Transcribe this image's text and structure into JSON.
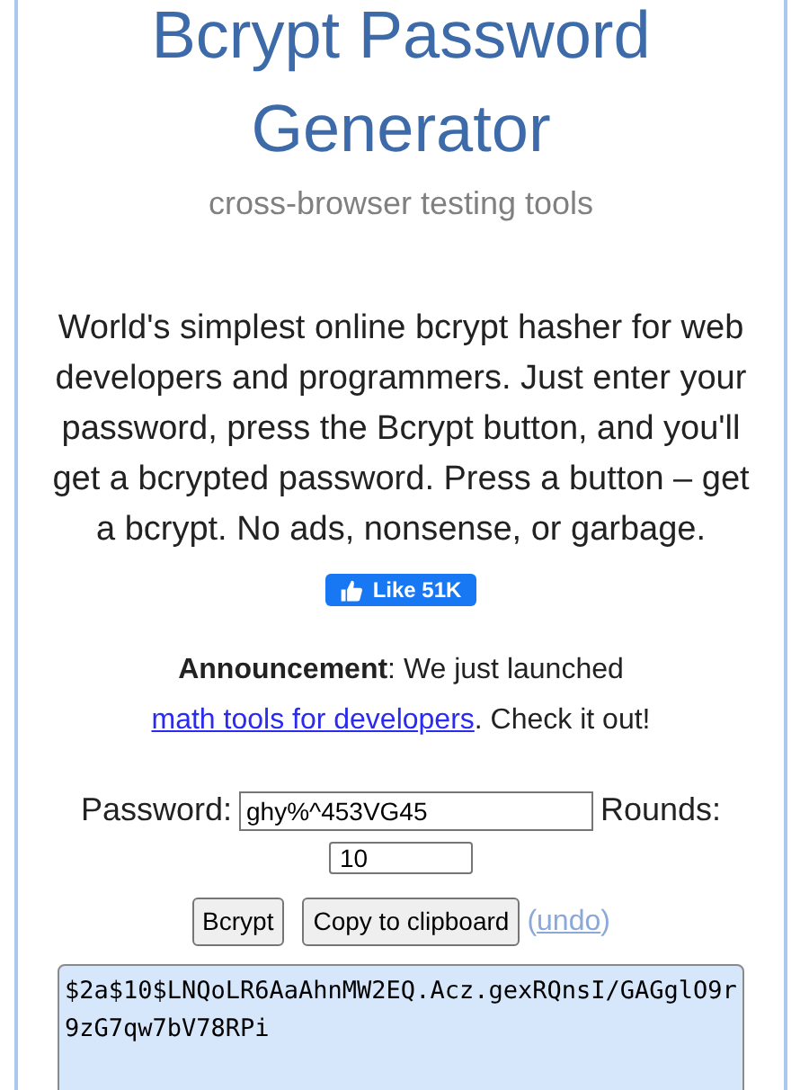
{
  "header": {
    "title": "Bcrypt Password Generator",
    "subtitle": "cross-browser testing tools"
  },
  "intro": "World's simplest online bcrypt hasher for web developers and programmers. Just enter your password, press the Bcrypt button, and you'll get a bcrypted password. Press a button – get a bcrypt. No ads, nonsense, or garbage.",
  "like_button": {
    "label": "Like 51K"
  },
  "announcement": {
    "before": "**Announcement**: We just launched ",
    "link": "math tools for developers",
    "after": ". Check it out!"
  },
  "form": {
    "password_label": "Password:",
    "password_value": "ghy%^453VG45",
    "rounds_label": "Rounds:",
    "rounds_value": "10"
  },
  "buttons": [
    {
      "label": "Bcrypt"
    },
    {
      "label": "Copy to clipboard"
    }
  ],
  "undo_link": {
    "open": "(",
    "label": "undo",
    "close": ")"
  },
  "output": "$2a$10$LNQoLR6AaAhnMW2EQ.Acz.gexRQnsI/GAGglO9r9zG7qw7bV78RPi"
}
